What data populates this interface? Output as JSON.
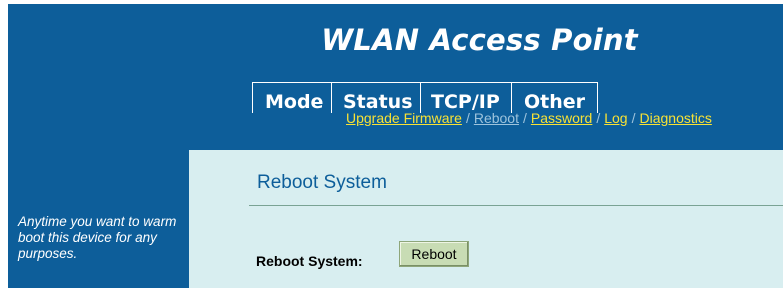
{
  "brand": {
    "title": "WLAN Access Point"
  },
  "nav": {
    "tabs": [
      {
        "label": "Mode"
      },
      {
        "label": "Status"
      },
      {
        "label": "TCP/IP"
      },
      {
        "label": "Other"
      }
    ],
    "sublinks": [
      {
        "label": "Upgrade Firmware",
        "current": false
      },
      {
        "label": "Reboot",
        "current": true
      },
      {
        "label": "Password",
        "current": false
      },
      {
        "label": "Log",
        "current": false
      },
      {
        "label": "Diagnostics",
        "current": false
      }
    ],
    "separator": "/"
  },
  "sidebar": {
    "help_text": "Anytime you want to warm boot this device for any purposes."
  },
  "main": {
    "title": "Reboot System",
    "field_label": "Reboot System:",
    "button_label": "Reboot"
  },
  "colors": {
    "header_bg": "#0d5e9a",
    "content_bg": "#d8eef0",
    "link": "#f8e235",
    "link_current": "#9dc3dc",
    "button_bg": "#c8dcb4"
  }
}
